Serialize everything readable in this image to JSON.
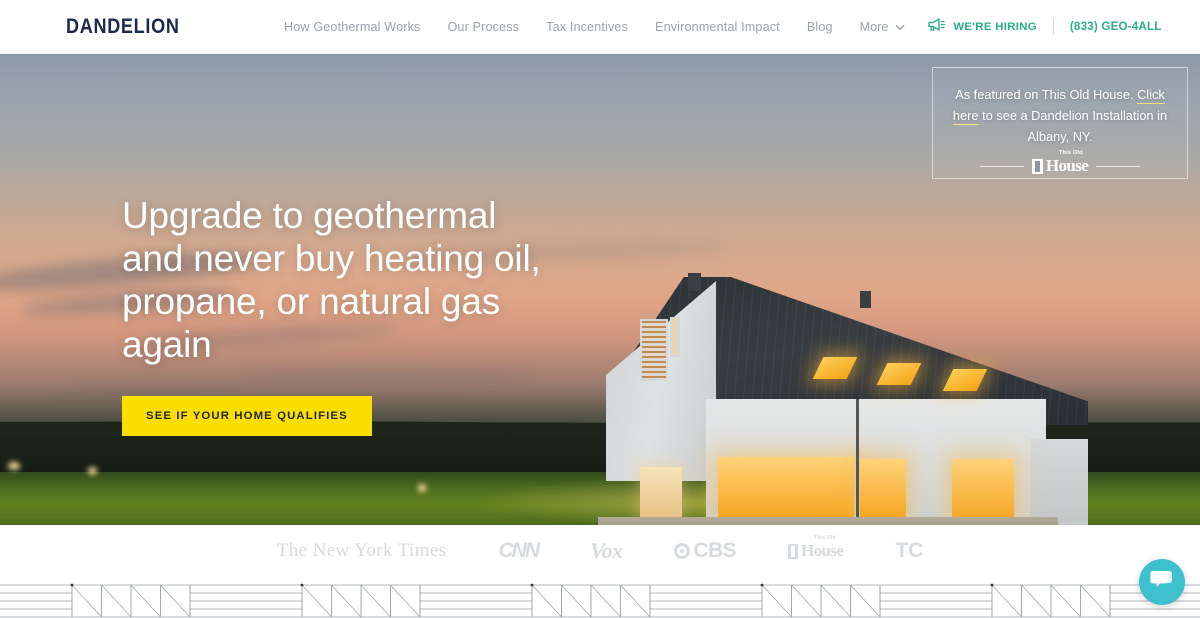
{
  "brand": {
    "name": "DANDELION"
  },
  "nav": {
    "links": [
      {
        "label": "How Geothermal Works"
      },
      {
        "label": "Our Process"
      },
      {
        "label": "Tax Incentives"
      },
      {
        "label": "Environmental Impact"
      },
      {
        "label": "Blog"
      }
    ],
    "more_label": "More",
    "more_icon": "chevron-down-icon",
    "hiring_icon": "megaphone-icon",
    "hiring_label": "WE'RE HIRING",
    "phone": "(833) GEO-4ALL",
    "accent_color": "#2aae8c",
    "link_color": "#9aa3ac"
  },
  "hero": {
    "headline": "Upgrade to geothermal and never buy heating oil, propane, or natural gas again",
    "cta_label": "SEE IF YOUR HOME QUALIFIES",
    "cta_color": "#fade00",
    "badge": {
      "line1": "As featured on This Old House.",
      "link_text": "Click here",
      "line2_rest": " to see a Dandelion",
      "line3": "Installation in Albany, NY.",
      "logo_small": "This Old",
      "logo_big": "House",
      "link_underline_color": "#f3e27a"
    }
  },
  "press": {
    "logos": [
      {
        "name": "The New York Times",
        "key": "nyt"
      },
      {
        "name": "CNN",
        "key": "cnn"
      },
      {
        "name": "Vox",
        "key": "vox"
      },
      {
        "name": "CBS",
        "key": "cbs"
      },
      {
        "name": "This Old House",
        "key": "toh",
        "small": "This Old",
        "big": "House"
      },
      {
        "name": "TC",
        "key": "tc"
      }
    ],
    "logo_color": "#d7dade"
  },
  "chat": {
    "icon": "chat-bubble-icon",
    "color": "#3fc0ce"
  }
}
